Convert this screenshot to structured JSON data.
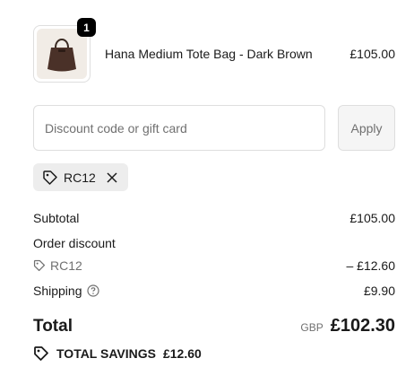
{
  "cart": {
    "item": {
      "name": "Hana Medium Tote Bag - Dark Brown",
      "price": "£105.00",
      "quantity": "1",
      "image_icon": "tote-bag-icon"
    }
  },
  "discount": {
    "placeholder": "Discount code or gift card",
    "value": "",
    "apply_label": "Apply",
    "applied_code": "RC12"
  },
  "summary": {
    "subtotal_label": "Subtotal",
    "subtotal_value": "£105.00",
    "order_discount_label": "Order discount",
    "discount_code": "RC12",
    "discount_value": "– £12.60",
    "shipping_label": "Shipping",
    "shipping_value": "£9.90",
    "total_label": "Total",
    "currency": "GBP",
    "total_value": "£102.30",
    "savings_label": "TOTAL SAVINGS",
    "savings_value": "£12.60"
  },
  "colors": {
    "badge": "#000000",
    "tag_bg": "#ededed",
    "muted": "#707070",
    "border": "#dedede"
  }
}
